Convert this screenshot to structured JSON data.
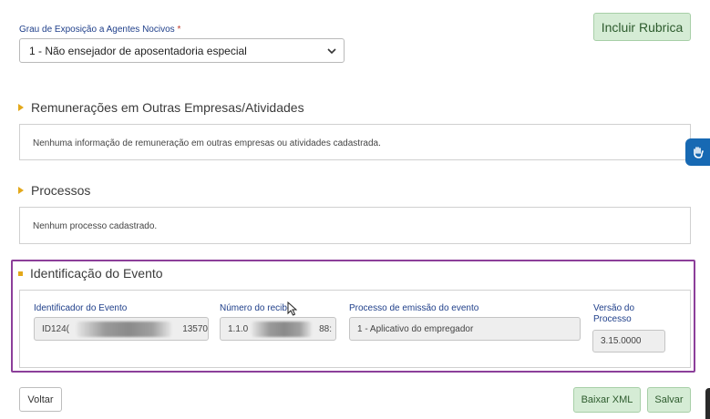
{
  "exposure": {
    "label": "Grau de Exposição a Agentes Nocivos",
    "required_mark": "*",
    "selected": "1 - Não ensejador de aposentadoria especial"
  },
  "buttons": {
    "incluir_rubrica": "Incluir Rubrica",
    "voltar": "Voltar",
    "baixar_xml": "Baixar XML",
    "salvar": "Salvar"
  },
  "remuneracoes": {
    "title": "Remunerações em Outras Empresas/Atividades",
    "empty_text": "Nenhuma informação de remuneração em outras empresas ou atividades cadastrada."
  },
  "processos": {
    "title": "Processos",
    "empty_text": "Nenhum processo cadastrado."
  },
  "evento": {
    "title": "Identificação do Evento",
    "fields": {
      "identificador": {
        "label": "Identificador do Evento",
        "value_start": "ID124(",
        "value_end": "13570"
      },
      "recibo": {
        "label": "Número do recibo",
        "value_start": "1.1.0",
        "value_end": "88:"
      },
      "processo_emissao": {
        "label": "Processo de emissão do evento",
        "value": "1 - Aplicativo do empregador"
      },
      "versao": {
        "label_line1": "Versão do",
        "label_line2": "Processo",
        "value": "3.15.0000"
      }
    }
  },
  "colors": {
    "accent_green": "#d5ecd5",
    "highlight_border": "#8c3f9a",
    "section_marker": "#e3a81a",
    "accessibility_blue": "#1769b3"
  },
  "icons": {
    "accessibility": "hand-sign-icon",
    "select_arrow": "chevron-down-icon",
    "cursor": "mouse-pointer-icon"
  }
}
